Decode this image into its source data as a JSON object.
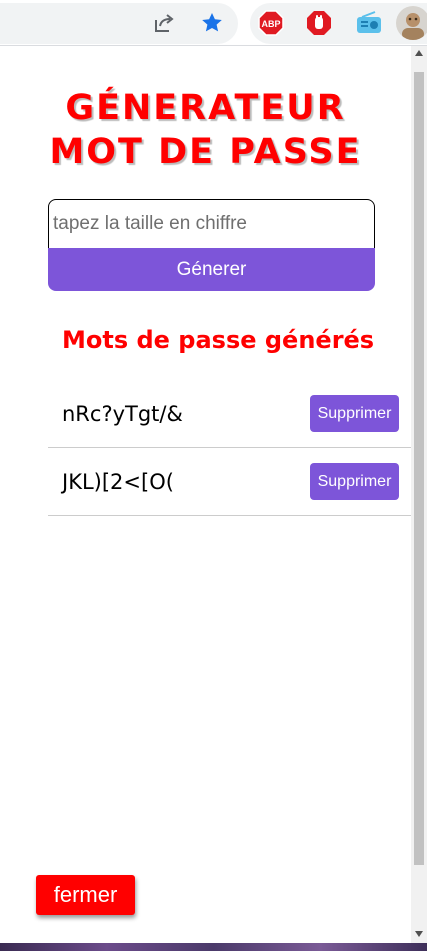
{
  "browser": {
    "icons": [
      "share-icon",
      "bookmark-star-icon",
      "adblock-plus-icon",
      "stop-hand-icon",
      "radio-icon",
      "profile-avatar-icon"
    ],
    "abp_label": "ABP",
    "star_color": "#1a73e8"
  },
  "popup": {
    "title_line1": "GÉNERATEUR",
    "title_line2": "MOT DE PASSE",
    "size_input": {
      "placeholder": "tapez la taille en chiffre",
      "value": ""
    },
    "generate_label": "Génerer",
    "list_heading": "Mots de passe générés",
    "passwords": [
      {
        "text": "nRc?yTgt/&",
        "delete_label": "Supprimer"
      },
      {
        "text": "JKL)[2<[O(",
        "delete_label": "Supprimer"
      }
    ],
    "close_label": "fermer",
    "colors": {
      "accent": "#7d55d9",
      "title": "#ff0000",
      "close": "#ff0000"
    }
  }
}
